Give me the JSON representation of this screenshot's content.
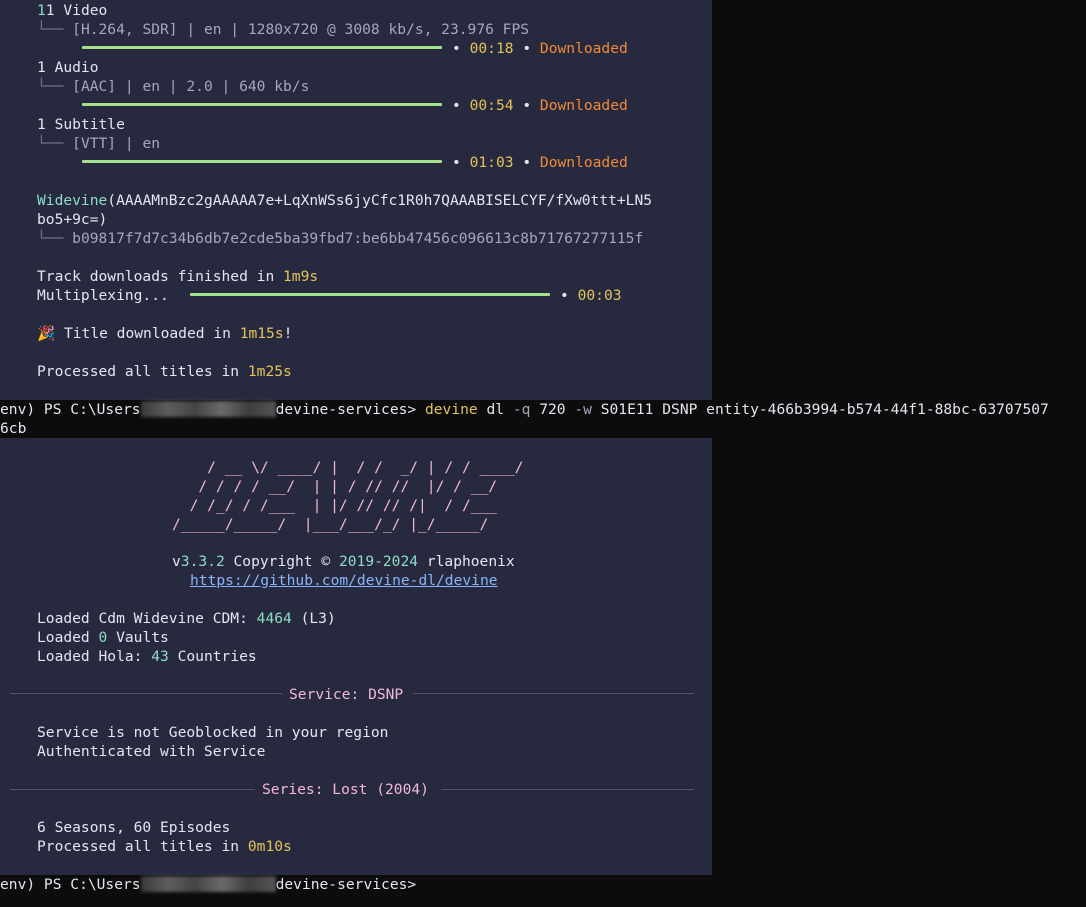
{
  "top": {
    "tracks": [
      {
        "heading": "1 Video",
        "detail": "[H.264, SDR] | en | 1280x720 @ 3008 kb/s, 23.976 FPS",
        "progress": 1.0,
        "time": "00:18",
        "status": "Downloaded"
      },
      {
        "heading": "1 Audio",
        "detail": "[AAC] | en | 2.0 | 640 kb/s",
        "progress": 1.0,
        "time": "00:54",
        "status": "Downloaded"
      },
      {
        "heading": "1 Subtitle",
        "detail": "[VTT] | en",
        "progress": 1.0,
        "time": "01:03",
        "status": "Downloaded"
      }
    ],
    "tree_branch": "└── ",
    "bullet": "•",
    "widevine": {
      "name": "Widevine",
      "pssh_line1": "(AAAAMnBzc2gAAAAA7e+LqXnWSs6jyCfc1R0h7QAAABISELCYF/fXw0ttt+LN5",
      "pssh_line2": "bo5+9c=)",
      "key": "b09817f7d7c34b6db7e2cde5ba39fbd7:be6bb47456c096613c8b71767277115f"
    },
    "track_finished": {
      "text": "Track downloads finished in ",
      "time": "1m9s"
    },
    "multiplex": {
      "label": "Multiplexing...",
      "progress": 1.0,
      "time": "00:03"
    },
    "title_done": {
      "emoji": "🎉",
      "text": " Title downloaded in ",
      "time": "1m15s",
      "suffix": "!"
    },
    "processed": {
      "text": "Processed all titles in ",
      "time": "1m25s"
    }
  },
  "prompt1": {
    "prefix": "env) PS C:\\Users",
    "suffix": "devine-services> ",
    "cmd": "devine",
    "args": [
      " dl ",
      "-q",
      " ",
      "720",
      " ",
      "-w",
      " S01E11 DSNP entity-466b3994-b574-44f1-88bc-63707507"
    ],
    "wrap": "6cb"
  },
  "bottom": {
    "ascii_art": "    / __ \\/ ____/ |  / /  _/ | / / ____/\n   / / / / __/  | | / // //  |/ / __/\n  / /_/ / /___  | |/ // // /|  / /___\n/_____/_____/  |___/___/_/ |_/_____/",
    "version_prefix": "v",
    "version": "3.3.2",
    "copyright_text": " Copyright © ",
    "year_range": "2019-2024",
    "author": " rlaphoenix",
    "url": "https://github.com/devine-dl/devine",
    "cdm": {
      "text": "Loaded Cdm Widevine CDM: ",
      "id": "4464",
      "level": " (L3)"
    },
    "vaults": {
      "text": "Loaded ",
      "count": "0",
      "suffix": " Vaults"
    },
    "hola": {
      "text": "Loaded Hola: ",
      "count": "43",
      "suffix": " Countries"
    },
    "service_rule": "Service: DSNP",
    "geo": "Service is not Geoblocked in your region",
    "auth": "Authenticated with Service",
    "series_rule": "Series: Lost (2004)",
    "seasons": "6 Seasons, 60 Episodes",
    "processed": {
      "text": "Processed all titles in ",
      "time": "0m10s"
    }
  },
  "prompt2": {
    "prefix": "env) PS C:\\Users",
    "suffix": "devine-services> "
  },
  "colors": {
    "panel_bg": "#272a3e",
    "bar": "#a5e28e",
    "time": "#e2c45a",
    "status": "#f0893a",
    "accent": "#8fdcc5",
    "art": "#f3b8d6"
  }
}
